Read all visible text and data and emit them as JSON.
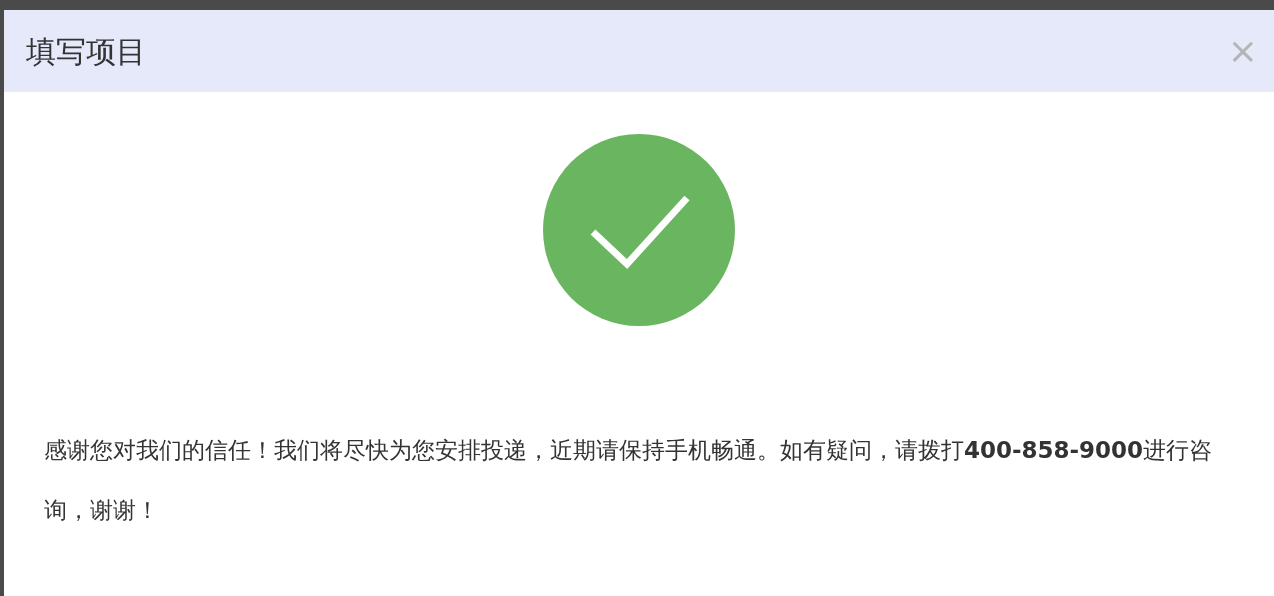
{
  "dialog": {
    "title": "填写项目",
    "close": "×",
    "message": "感谢您对我们的信任！我们将尽快为您安排投递，近期请保持手机畅通。如有疑问，请拨打**400-858-9000**进行咨询，谢谢！"
  }
}
